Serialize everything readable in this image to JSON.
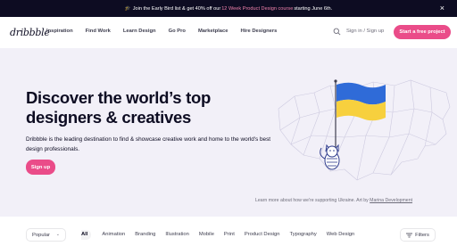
{
  "banner": {
    "text_before": "Join the Early Bird list & get 40% off our ",
    "highlight": "12 Week Product Design course",
    "text_after": " starting June 6th.",
    "icon": "mortarboard-icon",
    "close_label": "×"
  },
  "nav": {
    "logo": "dribbble",
    "links": [
      "Inspiration",
      "Find Work",
      "Learn Design",
      "Go Pro",
      "Marketplace",
      "Hire Designers"
    ],
    "search_icon": "search-icon",
    "signin": "Sign in / Sign up",
    "cta": "Start a free project"
  },
  "hero": {
    "title": "Discover the world’s top designers & creatives",
    "description": "Dribbble is the leading destination to find & showcase creative work and home to the world's best design professionals.",
    "signup": "Sign up",
    "credit_text": "Learn more about how we're supporting Ukraine. Art by ",
    "credit_link": "Marina Development",
    "flag_colors": [
      "#2f6bd8",
      "#f7d03e"
    ]
  },
  "filters": {
    "sort": "Popular",
    "categories": [
      "All",
      "Animation",
      "Branding",
      "Illustration",
      "Mobile",
      "Print",
      "Product Design",
      "Typography",
      "Web Design"
    ],
    "active": "All",
    "filter_button": "Filters"
  },
  "colors": {
    "accent": "#ea4c89",
    "dark": "#0d0c22",
    "hero_bg": "#f2f0f8"
  }
}
